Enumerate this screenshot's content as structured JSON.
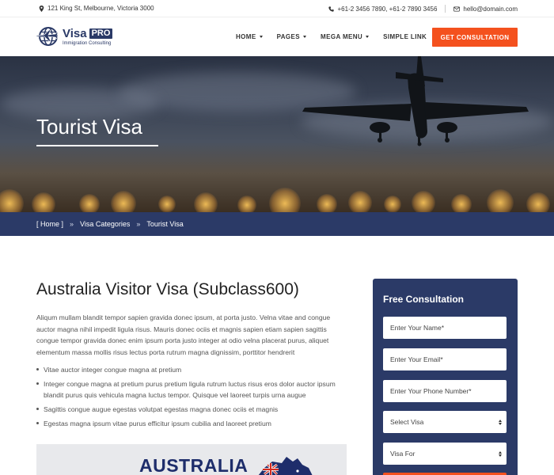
{
  "topbar": {
    "address": "121 King St, Melbourne, Victoria 3000",
    "phones": "+61-2 3456 7890,  +61-2 7890 3456",
    "email": "hello@domain.com"
  },
  "logo": {
    "brand": "Visa",
    "badge": "PRO",
    "tagline": "Immigration Consulting"
  },
  "nav": {
    "items": [
      {
        "label": "HOME",
        "dropdown": true
      },
      {
        "label": "PAGES",
        "dropdown": true
      },
      {
        "label": "MEGA MENU",
        "dropdown": true
      },
      {
        "label": "SIMPLE LINK",
        "dropdown": false
      }
    ],
    "cta": "GET CONSULTATION"
  },
  "hero": {
    "title": "Tourist Visa"
  },
  "breadcrumb": {
    "home": "[ Home ]",
    "sep": "»",
    "category": "Visa Categories",
    "current": "Tourist Visa"
  },
  "main": {
    "heading": "Australia Visitor Visa (Subclass600)",
    "paragraph": "Aliqum mullam blandit tempor sapien gravida donec ipsum, at porta justo. Velna vitae and congue auctor magna nihil impedit ligula risus. Mauris donec ociis et magnis sapien etiam sapien sagittis congue tempor gravida donec enim ipsum porta justo integer at odio velna placerat purus, aliquet elementum massa mollis risus lectus porta rutrum magna dignissim, porttitor hendrerit",
    "bullets": [
      "Vitae auctor integer congue magna at pretium",
      "Integer congue magna at pretium purus pretium ligula rutrum luctus risus eros dolor auctor ipsum blandit purus quis vehicula magna luctus tempor. Quisque vel laoreet turpis urna augue",
      "Sagittis congue augue egestas volutpat egestas magna donec ociis et magnis",
      "Egestas magna ipsum vitae purus efficitur ipsum cubilia and laoreet pretium"
    ],
    "image_text": "AUSTRALIA"
  },
  "form": {
    "title": "Free Consultation",
    "name_placeholder": "Enter Your Name*",
    "email_placeholder": "Enter Your Email*",
    "phone_placeholder": "Enter Your Phone Number*",
    "select_visa": "Select Visa",
    "visa_for": "Visa For"
  },
  "colors": {
    "navy": "#2b3a67",
    "accent": "#f4511e"
  }
}
